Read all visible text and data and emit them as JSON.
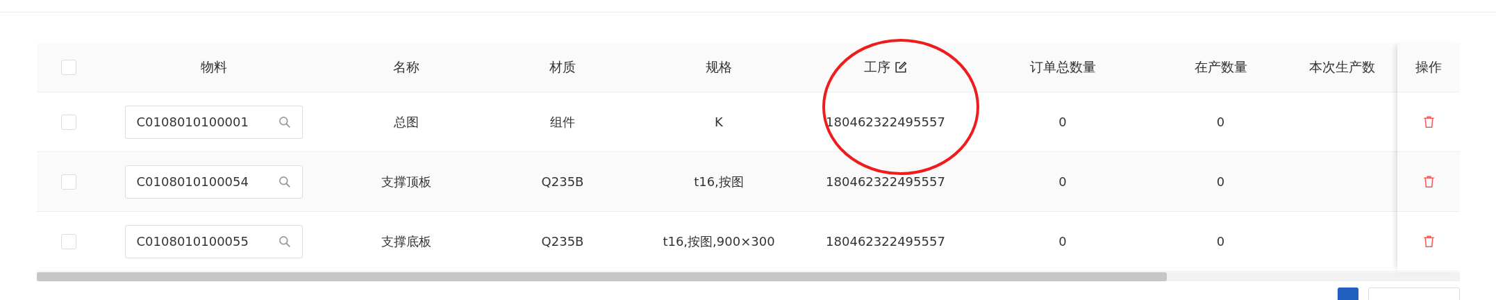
{
  "table": {
    "columns": [
      {
        "kind": "checkbox",
        "checked": false
      },
      {
        "kind": "text",
        "label": "物料"
      },
      {
        "kind": "text",
        "label": "名称"
      },
      {
        "kind": "text",
        "label": "材质"
      },
      {
        "kind": "text",
        "label": "规格"
      },
      {
        "kind": "editable",
        "label": "工序"
      },
      {
        "kind": "text",
        "label": "订单总数量"
      },
      {
        "kind": "text",
        "label": "在产数量"
      },
      {
        "kind": "text",
        "label": "本次生产数"
      }
    ],
    "action_column": {
      "label": "操作"
    },
    "rows": [
      {
        "checked": false,
        "material": "C0108010100001",
        "name": "总图",
        "texture": "组件",
        "spec": "K",
        "process": "180462322495557",
        "order_qty": "0",
        "in_production_qty": "0"
      },
      {
        "checked": false,
        "material": "C0108010100054",
        "name": "支撑顶板",
        "texture": "Q235B",
        "spec": "t16,按图",
        "process": "180462322495557",
        "order_qty": "0",
        "in_production_qty": "0"
      },
      {
        "checked": false,
        "material": "C0108010100055",
        "name": "支撑底板",
        "texture": "Q235B",
        "spec": "t16,按图,900×300",
        "process": "180462322495557",
        "order_qty": "0",
        "in_production_qty": "0"
      }
    ]
  },
  "pagination": {
    "pages": [
      {
        "selected": true
      }
    ]
  }
}
